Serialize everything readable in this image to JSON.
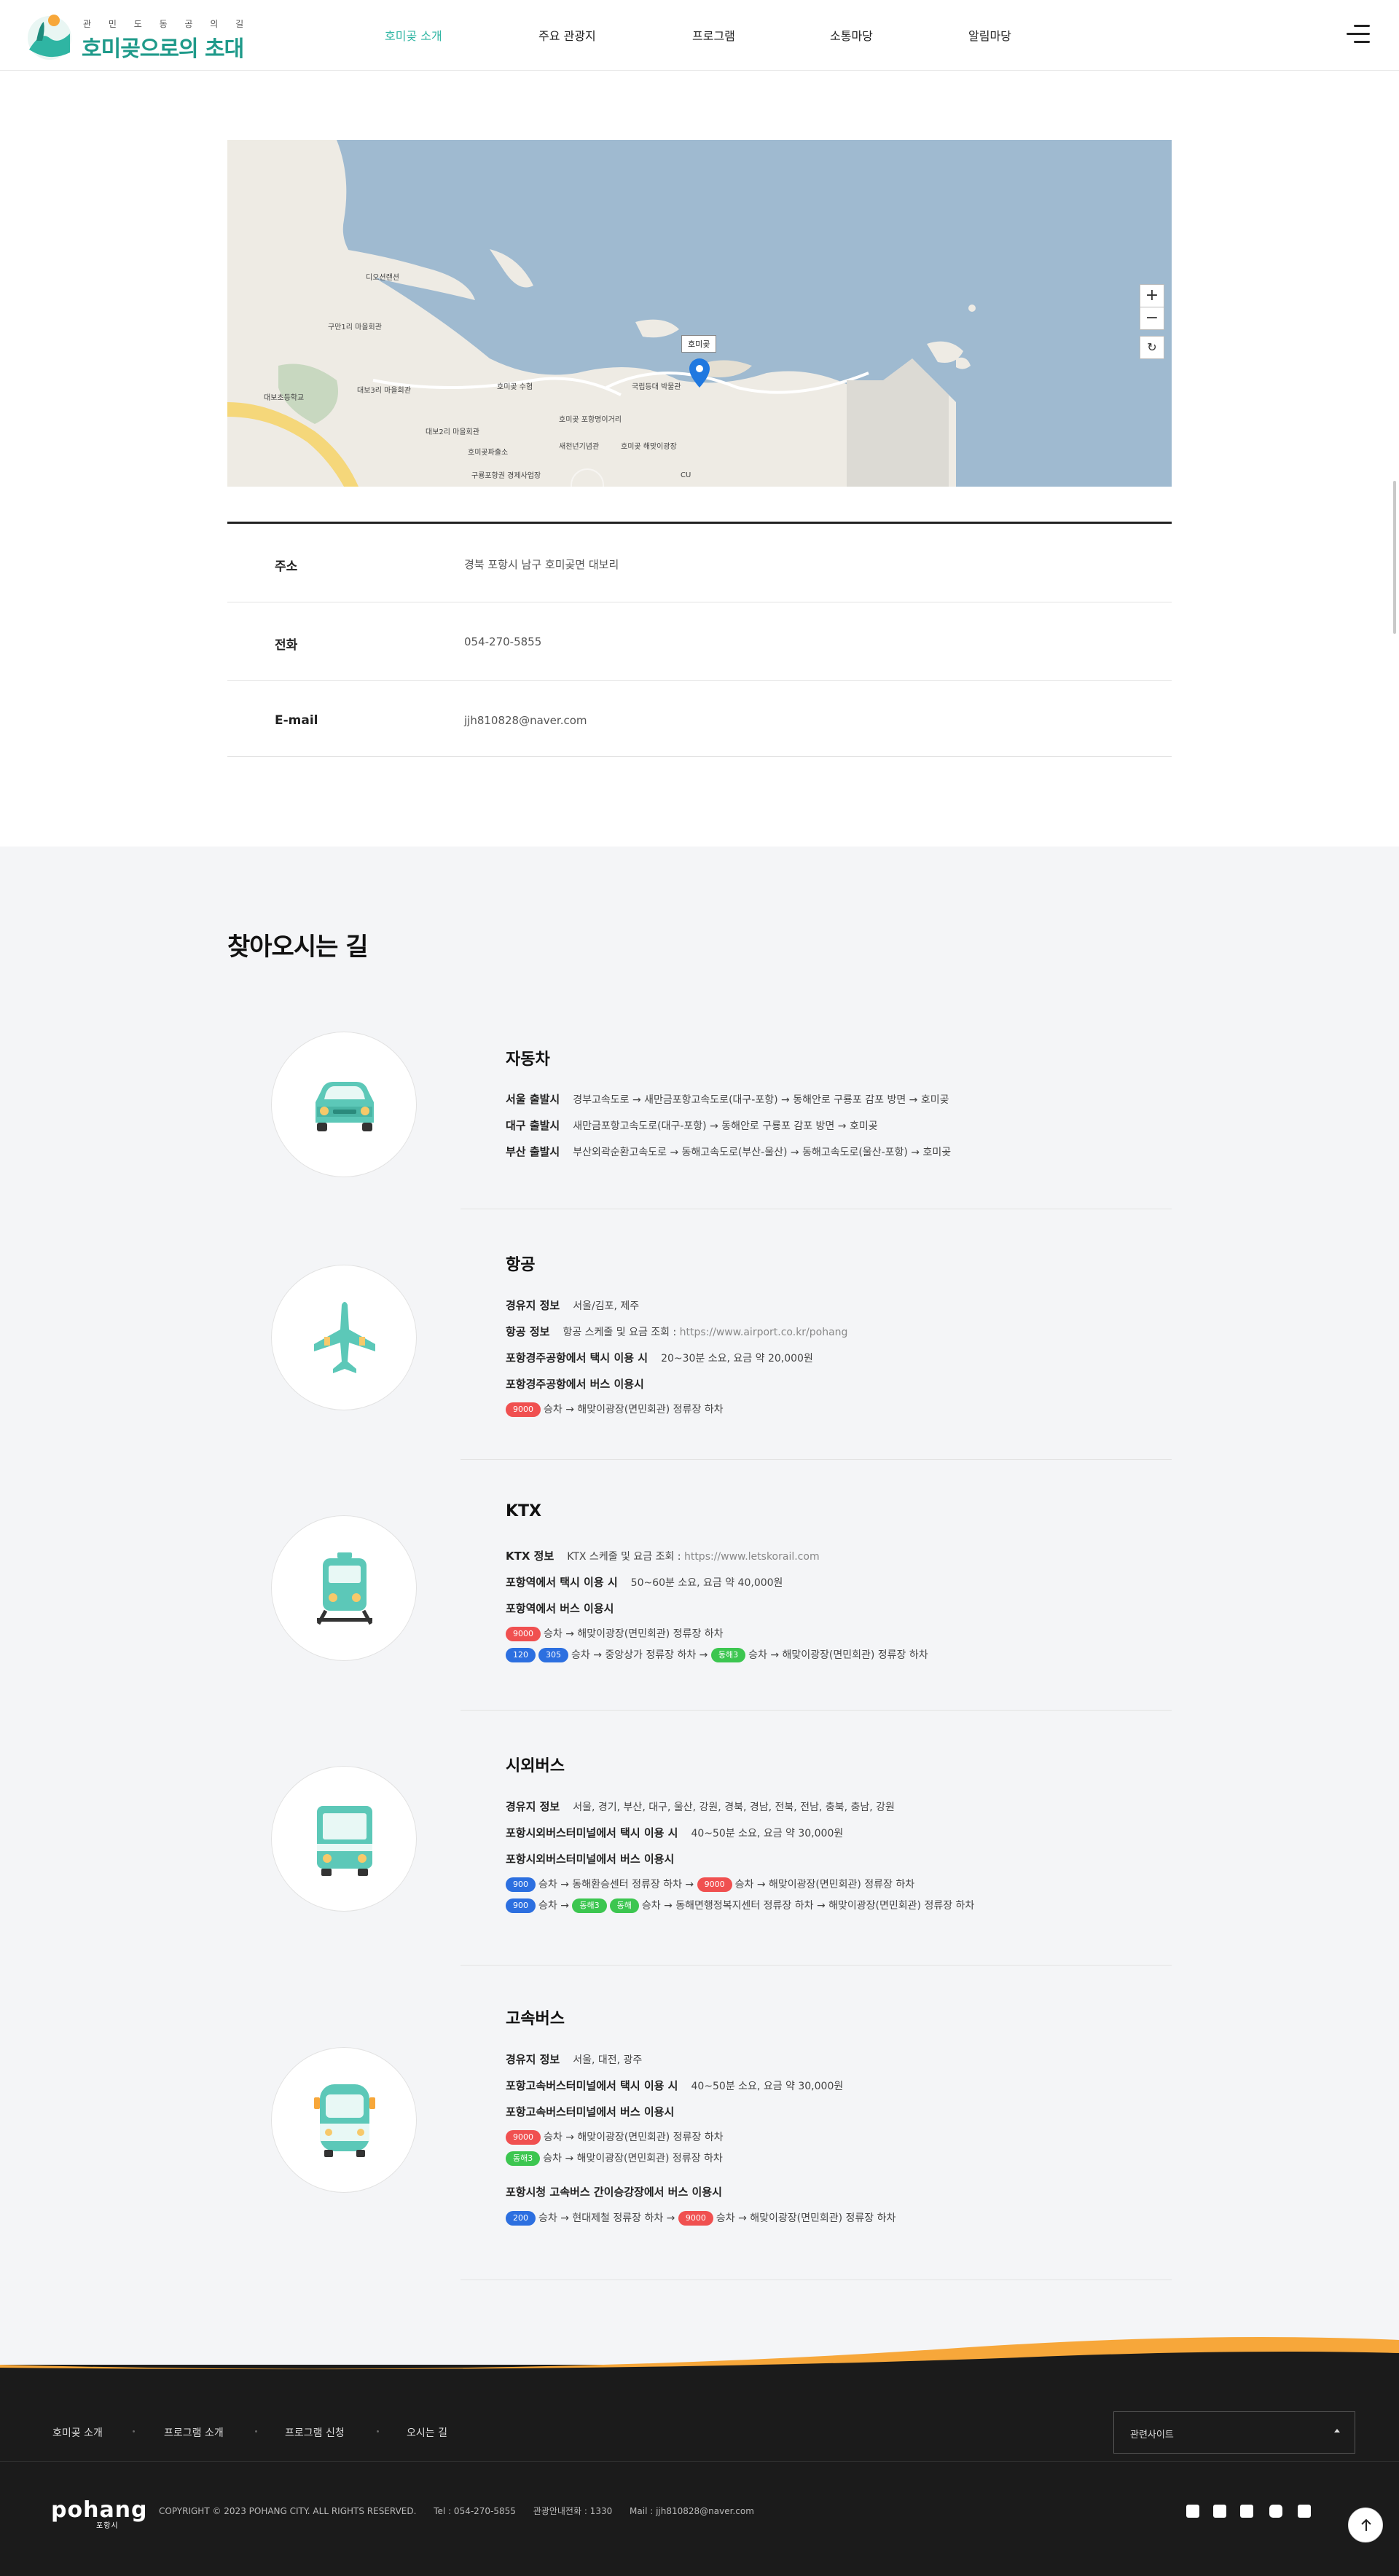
{
  "header": {
    "logo_small": "관 민 도 동 공 의 길",
    "logo_big": "호미곶으로의 초대",
    "nav": [
      "호미곶 소개",
      "주요 관광지",
      "프로그램",
      "소통마당",
      "알림마당"
    ]
  },
  "map": {
    "pin_label": "호미곶",
    "zoom_in": "+",
    "zoom_out": "−",
    "reset": "↻",
    "labels": [
      "디오션랜션",
      "구만1리 마을회관",
      "대보초등학교",
      "대보3리 마을회관",
      "호미곶 수협",
      "대보2리 마을회관",
      "호미곶파출소",
      "구룡포항권 경제사업장",
      "국립등대 박물관",
      "새천년기념관",
      "호미곶 해맞이광장",
      "CU",
      "호미곶 포항명이거리"
    ]
  },
  "info": [
    {
      "key": "주소",
      "value": "경북 포항시 남구 호미곶면 대보리"
    },
    {
      "key": "전화",
      "value": "054-270-5855"
    },
    {
      "key": "E-mail",
      "value": "jjh810828@naver.com"
    }
  ],
  "directions": {
    "title": "찾아오시는 길",
    "car": {
      "title": "자동차",
      "lines": [
        {
          "label": "서울 출발시",
          "text": "경부고속도로 → 새만금포항고속도로(대구-포항) → 동해안로 구룡포 감포 방면 → 호미곶"
        },
        {
          "label": "대구 출발시",
          "text": "새만금포항고속도로(대구-포항) → 동해안로 구룡포 감포 방면 → 호미곶"
        },
        {
          "label": "부산 출발시",
          "text": "부산외곽순환고속도로 → 동해고속도로(부산-울산) → 동해고속도로(울산-포항) → 호미곶"
        }
      ]
    },
    "air": {
      "title": "항공",
      "route_label": "경유지 정보",
      "route_text": "서울/김포, 제주",
      "info_label": "항공 정보",
      "info_text": "항공 스케줄 및 요금 조회 : ",
      "info_link": "https://www.airport.co.kr/pohang",
      "taxi_label": "포항경주공항에서 택시 이용 시",
      "taxi_text": "20~30분 소요, 요금 약 20,000원",
      "bus_label": "포항경주공항에서 버스 이용시",
      "bus1_badge": "9000",
      "bus1_text": "승차 → 해맞이광장(면민회관) 정류장 하차"
    },
    "ktx": {
      "title": "KTX",
      "info_label": "KTX 정보",
      "info_text": "KTX 스케줄 및 요금 조회 : ",
      "info_link": "https://www.letskorail.com",
      "taxi_label": "포항역에서 택시 이용 시",
      "taxi_text": "50~60분 소요, 요금 약 40,000원",
      "bus_label": "포항역에서 버스 이용시",
      "bus1_badge": "9000",
      "bus1_text": "승차 → 해맞이광장(면민회관) 정류장 하차",
      "bus2_badge_a": "120",
      "bus2_badge_b": "305",
      "bus2_text_a": "승차 → 중앙상가 정류장 하차 →",
      "bus2_badge_c": "동해3",
      "bus2_text_b": "승차 → 해맞이광장(면민회관) 정류장 하차"
    },
    "intercity": {
      "title": "시외버스",
      "route_label": "경유지 정보",
      "route_text": "서울, 경기, 부산, 대구, 울산, 강원, 경북, 경남, 전북, 전남, 충북, 충남, 강원",
      "taxi_label": "포항시외버스터미널에서 택시 이용 시",
      "taxi_text": "40~50분 소요, 요금 약 30,000원",
      "bus_label": "포항시외버스터미널에서 버스 이용시",
      "bus1_badge": "900",
      "bus1_text_a": "승차 → 동해환승센터 정류장 하차 →",
      "bus1_badge_b": "9000",
      "bus1_text_b": "승차 → 해맞이광장(면민회관) 정류장 하차",
      "bus2_badge": "900",
      "bus2_text_a": "승차 →",
      "bus2_badge_b": "동해3",
      "bus2_badge_c": "동해",
      "bus2_text_b": "승차 → 동해면행정복지센터 정류장 하차 → 해맞이광장(면민회관) 정류장 하차"
    },
    "express": {
      "title": "고속버스",
      "route_label": "경유지 정보",
      "route_text": "서울, 대전, 광주",
      "taxi_label": "포항고속버스터미널에서 택시 이용 시",
      "taxi_text": "40~50분 소요, 요금 약 30,000원",
      "bus_label": "포항고속버스터미널에서 버스 이용시",
      "bus1_badge": "9000",
      "bus1_text": "승차 → 해맞이광장(면민회관) 정류장 하차",
      "bus2_badge": "동해3",
      "bus2_text": "승차 → 해맞이광장(면민회관) 정류장 하차",
      "city_label": "포항시청 고속버스 간이승강장에서 버스 이용시",
      "city_badge": "200",
      "city_text_a": "승차 → 현대제철 정류장 하차 →",
      "city_badge_b": "9000",
      "city_text_b": "승차 → 해맞이광장(면민회관) 정류장 하차"
    }
  },
  "footer": {
    "nav": [
      "호미곶 소개",
      "프로그램 소개",
      "프로그램 신청",
      "오시는 길"
    ],
    "related": "관련사이트",
    "logo": "pohang",
    "logo_sub": "포항시",
    "copyright": "COPYRIGHT © 2023 POHANG CITY. ALL RIGHTS RESERVED.",
    "tel": "Tel : 054-270-5855",
    "guide": "관광안내전화 : 1330",
    "mail": "Mail : jjh810828@naver.com"
  },
  "colors": {
    "accent": "#2fb5a3",
    "teal": "#5cc8b8",
    "red": "#f05050",
    "blue": "#2c6fe0",
    "green": "#3cc650",
    "orange": "#f7a73a"
  }
}
